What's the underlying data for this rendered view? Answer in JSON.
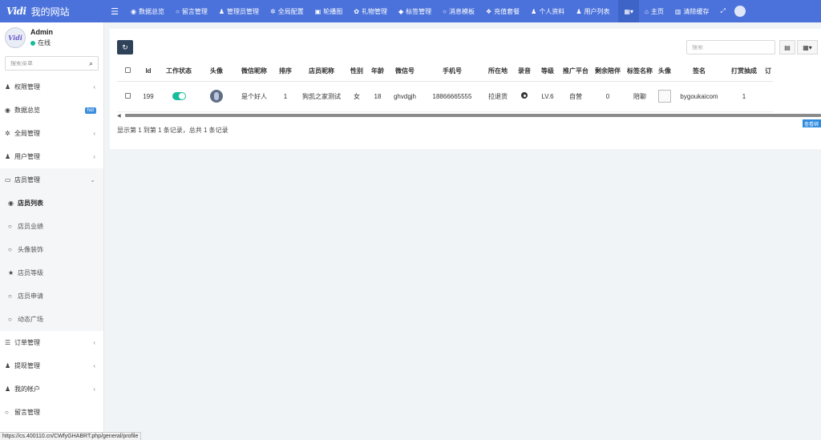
{
  "brand": {
    "logo_mark": "Vidi",
    "site_name": "我的网站"
  },
  "topnav": {
    "items": [
      {
        "label": "数据总览",
        "icon": "dashboard-icon",
        "glyph": "◉"
      },
      {
        "label": "留言管理",
        "icon": "circle-icon",
        "glyph": "○"
      },
      {
        "label": "管理员管理",
        "icon": "user-icon",
        "glyph": "♟"
      },
      {
        "label": "全局配置",
        "icon": "gear-icon",
        "glyph": "✲"
      },
      {
        "label": "轮播图",
        "icon": "image-icon",
        "glyph": "▣"
      },
      {
        "label": "礼物管理",
        "icon": "gift-icon",
        "glyph": "✿"
      },
      {
        "label": "标签管理",
        "icon": "tag-icon",
        "glyph": "◆"
      },
      {
        "label": "消息模板",
        "icon": "circle-icon",
        "glyph": "○"
      },
      {
        "label": "充值套餐",
        "icon": "cubes-icon",
        "glyph": "❖"
      },
      {
        "label": "个人资料",
        "icon": "user-icon",
        "glyph": "♟"
      },
      {
        "label": "用户列表",
        "icon": "user-icon",
        "glyph": "♟"
      }
    ],
    "right": {
      "dropdown_glyph": "▦▾",
      "home_label": "主页",
      "clear_cache_label": "清除缓存",
      "fullscreen_glyph": "⤢"
    }
  },
  "sidebar": {
    "user": {
      "name": "Admin",
      "status": "在线"
    },
    "search_placeholder": "搜索菜单",
    "menu": [
      {
        "label": "权限管理",
        "icon": "group-icon",
        "glyph": "♟",
        "arrow": "‹"
      },
      {
        "label": "数据总览",
        "icon": "dashboard-icon",
        "glyph": "◉",
        "badge": "hot"
      },
      {
        "label": "全局管理",
        "icon": "cogs-icon",
        "glyph": "✲",
        "arrow": "‹"
      },
      {
        "label": "用户管理",
        "icon": "group-icon",
        "glyph": "♟",
        "arrow": "‹"
      },
      {
        "label": "店员管理",
        "icon": "id-card-icon",
        "glyph": "▭",
        "arrow": "⌄"
      }
    ],
    "submenu": [
      {
        "label": "店员列表",
        "icon": "user-circle-icon",
        "glyph": "◉"
      },
      {
        "label": "店员业绩",
        "icon": "circle-icon",
        "glyph": "○"
      },
      {
        "label": "头像装饰",
        "icon": "circle-icon",
        "glyph": "○"
      },
      {
        "label": "店员等级",
        "icon": "star-icon",
        "glyph": "★"
      },
      {
        "label": "店员申请",
        "icon": "circle-icon",
        "glyph": "○"
      },
      {
        "label": "动态广场",
        "icon": "circle-icon",
        "glyph": "○"
      }
    ],
    "menu_bottom": [
      {
        "label": "订单管理",
        "icon": "list-icon",
        "glyph": "☰",
        "arrow": "‹"
      },
      {
        "label": "提现管理",
        "icon": "group-icon",
        "glyph": "♟",
        "arrow": "‹"
      },
      {
        "label": "我的帐户",
        "icon": "user-icon",
        "glyph": "♟",
        "arrow": "‹"
      },
      {
        "label": "留言管理",
        "icon": "circle-icon",
        "glyph": "○"
      }
    ]
  },
  "toolbar": {
    "refresh_glyph": "↻",
    "search_placeholder": "搜索",
    "view_toggle_glyph": "▤",
    "columns_glyph": "▦▾"
  },
  "table": {
    "headers": [
      "Id",
      "工作状态",
      "头像",
      "微信昵称",
      "排序",
      "店员昵称",
      "性别",
      "年龄",
      "微信号",
      "手机号",
      "所在地",
      "录音",
      "等级",
      "推广平台",
      "剩余陪伴",
      "标签名称",
      "头像",
      "签名",
      "打赏抽成",
      "订"
    ],
    "rows": [
      {
        "id": "199",
        "nickname_wx": "是个好人",
        "sort": "1",
        "nickname": "狗凯之家测试",
        "gender": "女",
        "age": "18",
        "wechat": "ghvdgjh",
        "phone": "18866665555",
        "location": "拉退货",
        "level": "LV.6",
        "platform": "自营",
        "remaining": "0",
        "tag": "陪聊",
        "signature": "bygoukaicom",
        "commission": "1",
        "action_label": "查看绑"
      }
    ]
  },
  "pager": {
    "text": "显示第 1 到第 1 条记录，总共 1 条记录"
  },
  "statusbar": {
    "url": "https://cs.400110.cn/CWfyGHABRT.php/general/profile"
  },
  "colors": {
    "topbar": "#4b72db",
    "online": "#18bc9c",
    "toggle_on": "#18bc9c",
    "hot_badge": "#3c8dde"
  }
}
